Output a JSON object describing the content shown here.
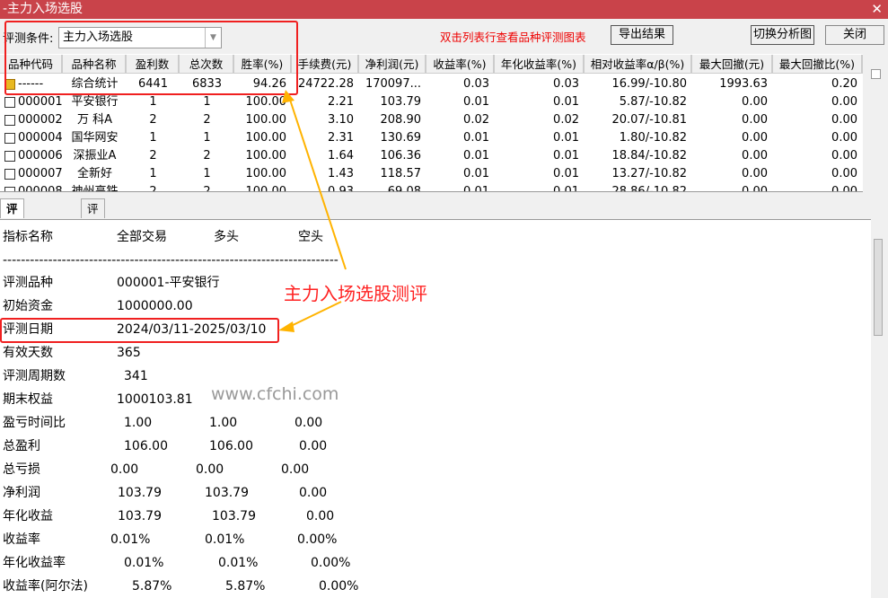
{
  "window": {
    "title": "-主力入场选股",
    "close_icon": "close-icon"
  },
  "toolbar": {
    "condition_label": "评测条件:",
    "condition_value": "主力入场选股",
    "hint": "双击列表行查看品种评测图表",
    "export_label": "导出结果",
    "switch_label": "切换分析图",
    "close_label": "关闭"
  },
  "table": {
    "headers": [
      "品种代码",
      "品种名称",
      "盈利数",
      "总次数",
      "胜率(%)",
      "手续费(元)",
      "净利润(元)",
      "收益率(%)",
      "年化收益率(%)",
      "相对收益率α/β(%)",
      "最大回撤(元)",
      "最大回撤比(%)"
    ],
    "rows": [
      [
        "------",
        "综合统计",
        "6441",
        "6833",
        "94.26",
        "24722.28",
        "170097...",
        "0.03",
        "0.03",
        "16.99/-10.80",
        "1993.63",
        "0.20"
      ],
      [
        "000001",
        "平安银行",
        "1",
        "1",
        "100.00",
        "2.21",
        "103.79",
        "0.01",
        "0.01",
        "5.87/-10.82",
        "0.00",
        "0.00"
      ],
      [
        "000002",
        "万 科A",
        "2",
        "2",
        "100.00",
        "3.10",
        "208.90",
        "0.02",
        "0.02",
        "20.07/-10.81",
        "0.00",
        "0.00"
      ],
      [
        "000004",
        "国华网安",
        "1",
        "1",
        "100.00",
        "2.31",
        "130.69",
        "0.01",
        "0.01",
        "1.80/-10.82",
        "0.00",
        "0.00"
      ],
      [
        "000006",
        "深振业A",
        "2",
        "2",
        "100.00",
        "1.64",
        "106.36",
        "0.01",
        "0.01",
        "18.84/-10.82",
        "0.00",
        "0.00"
      ],
      [
        "000007",
        "全新好",
        "1",
        "1",
        "100.00",
        "1.43",
        "118.57",
        "0.01",
        "0.01",
        "13.27/-10.82",
        "0.00",
        "0.00"
      ],
      [
        "000008",
        "神州高铁",
        "2",
        "2",
        "100.00",
        "0.93",
        "69.08",
        "0.01",
        "0.01",
        "28.86/-10.82",
        "0.00",
        "0.00"
      ]
    ]
  },
  "tabs": [
    "评测指标详情",
    "评测指标说明"
  ],
  "detail": {
    "header": [
      "指标名称",
      "全部交易",
      "多头",
      "空头"
    ],
    "divider": "--------------------------------------------------------------------------",
    "rows": [
      [
        "评测品种",
        "000001-平安银行"
      ],
      [
        "初始资金",
        "1000000.00"
      ],
      [
        "评测日期",
        "2024/03/11-2025/03/10"
      ],
      [
        "有效天数",
        "365"
      ],
      [
        "评测周期数",
        "341"
      ],
      [
        "期末权益",
        "1000103.81"
      ],
      [
        "盈亏时间比",
        "1.00",
        "1.00",
        "0.00"
      ],
      [
        "总盈利",
        "106.00",
        "106.00",
        "0.00"
      ],
      [
        "总亏损",
        "0.00",
        "0.00",
        "0.00"
      ],
      [
        "净利润",
        "103.79",
        "103.79",
        "0.00"
      ],
      [
        "年化收益",
        "103.79",
        "103.79",
        "0.00"
      ],
      [
        "收益率",
        "0.01%",
        "0.01%",
        "0.00%"
      ],
      [
        "年化收益率",
        "0.01%",
        "0.01%",
        "0.00%"
      ],
      [
        "收益率(阿尔法)",
        "5.87%",
        "5.87%",
        "0.00%"
      ]
    ]
  },
  "annotation": {
    "text": "主力入场选股测评",
    "color": "#ff2222",
    "arrow_color": "#ffb300"
  },
  "watermark": "www.cfchi.com"
}
